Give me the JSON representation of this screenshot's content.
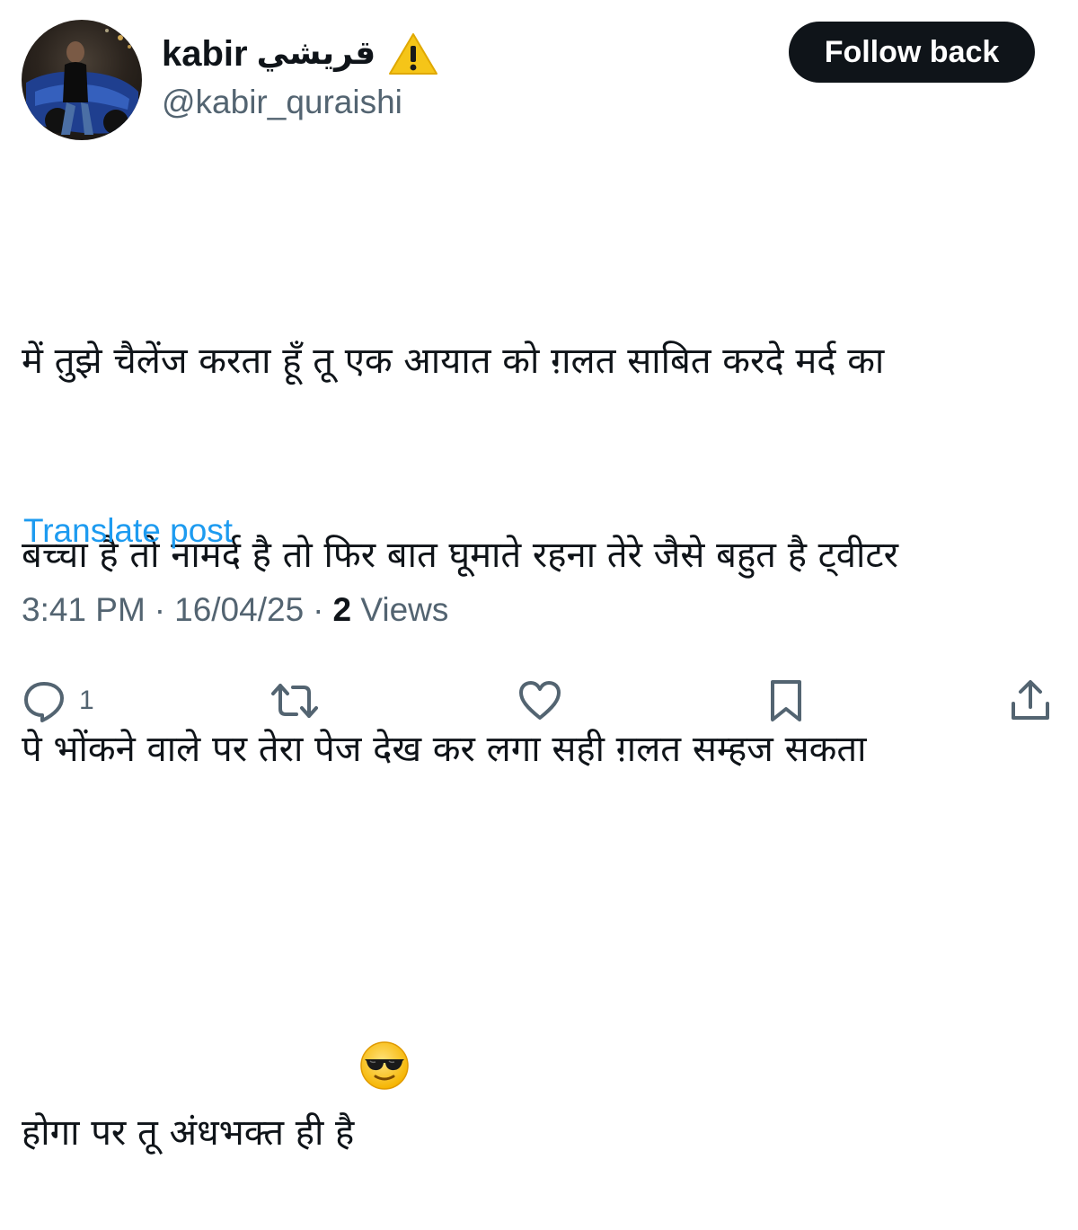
{
  "user": {
    "name": "kabir",
    "name_arabic": "قريشي",
    "handle": "@kabir_quraishi"
  },
  "follow_button": {
    "label": "Follow back"
  },
  "post": {
    "lines": [
      "में तुझे चैलेंज करता हूँ तू एक आयात को ग़लत साबित करदे मर्द का",
      "बच्चा है तो नामर्द है तो फिर बात घूमाते रहना तेरे जैसे बहुत है ट्वीटर",
      "पे भोंकने वाले पर तेरा पेज देख कर लगा सही ग़लत सम्हज सकता",
      "होगा पर तू अंधभक्त ही है"
    ],
    "translate_label": "Translate post"
  },
  "meta": {
    "time": "3:41 PM",
    "date": "16/04/25",
    "views_count": "2",
    "views_label": "Views",
    "separator": "·"
  },
  "actions": {
    "reply_count": "1"
  },
  "colors": {
    "link": "#1d9bf0",
    "muted": "#536471",
    "text": "#0f1419",
    "warning": "#f5c518"
  },
  "icons": {
    "warning": "warning-icon",
    "emoji": "sunglasses-emoji",
    "reply": "reply-icon",
    "repost": "repost-icon",
    "like": "heart-icon",
    "bookmark": "bookmark-icon",
    "share": "share-icon"
  }
}
